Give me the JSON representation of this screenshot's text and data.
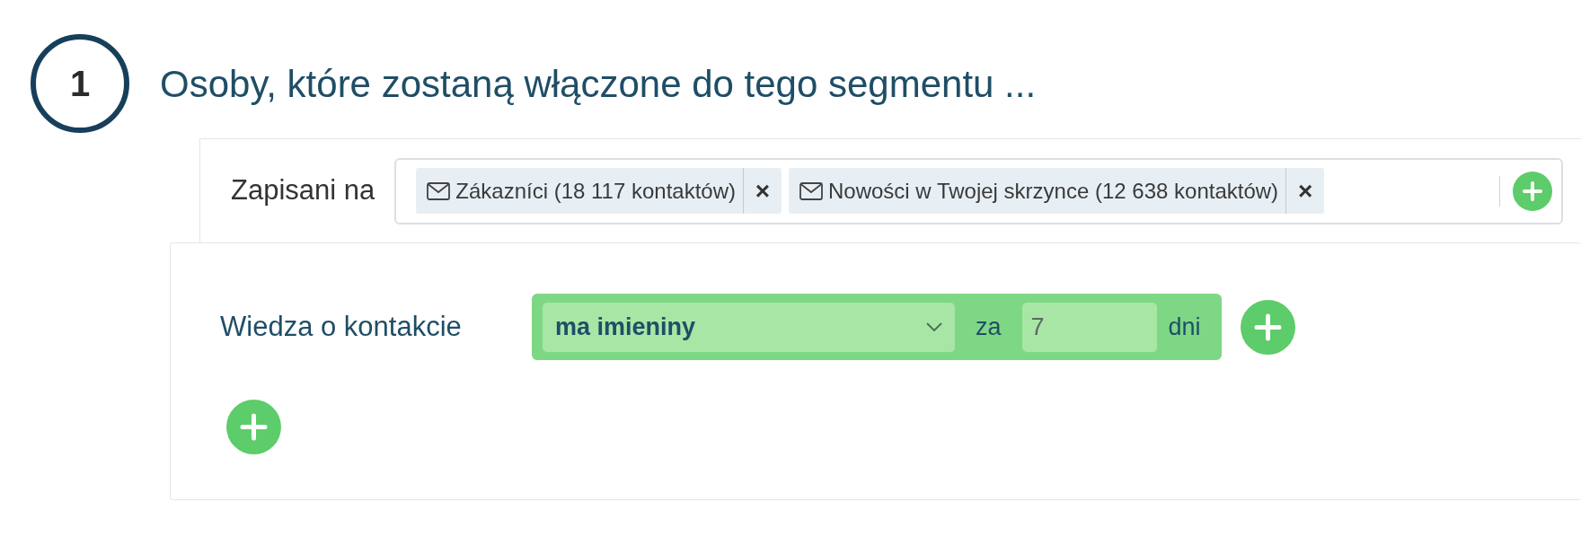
{
  "step": {
    "number": "1",
    "title": "Osoby, które zostaną włączone do tego segmentu ..."
  },
  "subscribed": {
    "label": "Zapisani na",
    "tags": [
      {
        "label": "Zákazníci (18 117 kontaktów)",
        "remove": "×"
      },
      {
        "label": "Nowości w Twojej skrzynce (12 638 kontaktów)",
        "remove": "×"
      }
    ]
  },
  "condition": {
    "label": "Wiedza o kontakcie",
    "select": "ma imieniny",
    "prefix": "za",
    "input": "7",
    "suffix": "dni"
  }
}
